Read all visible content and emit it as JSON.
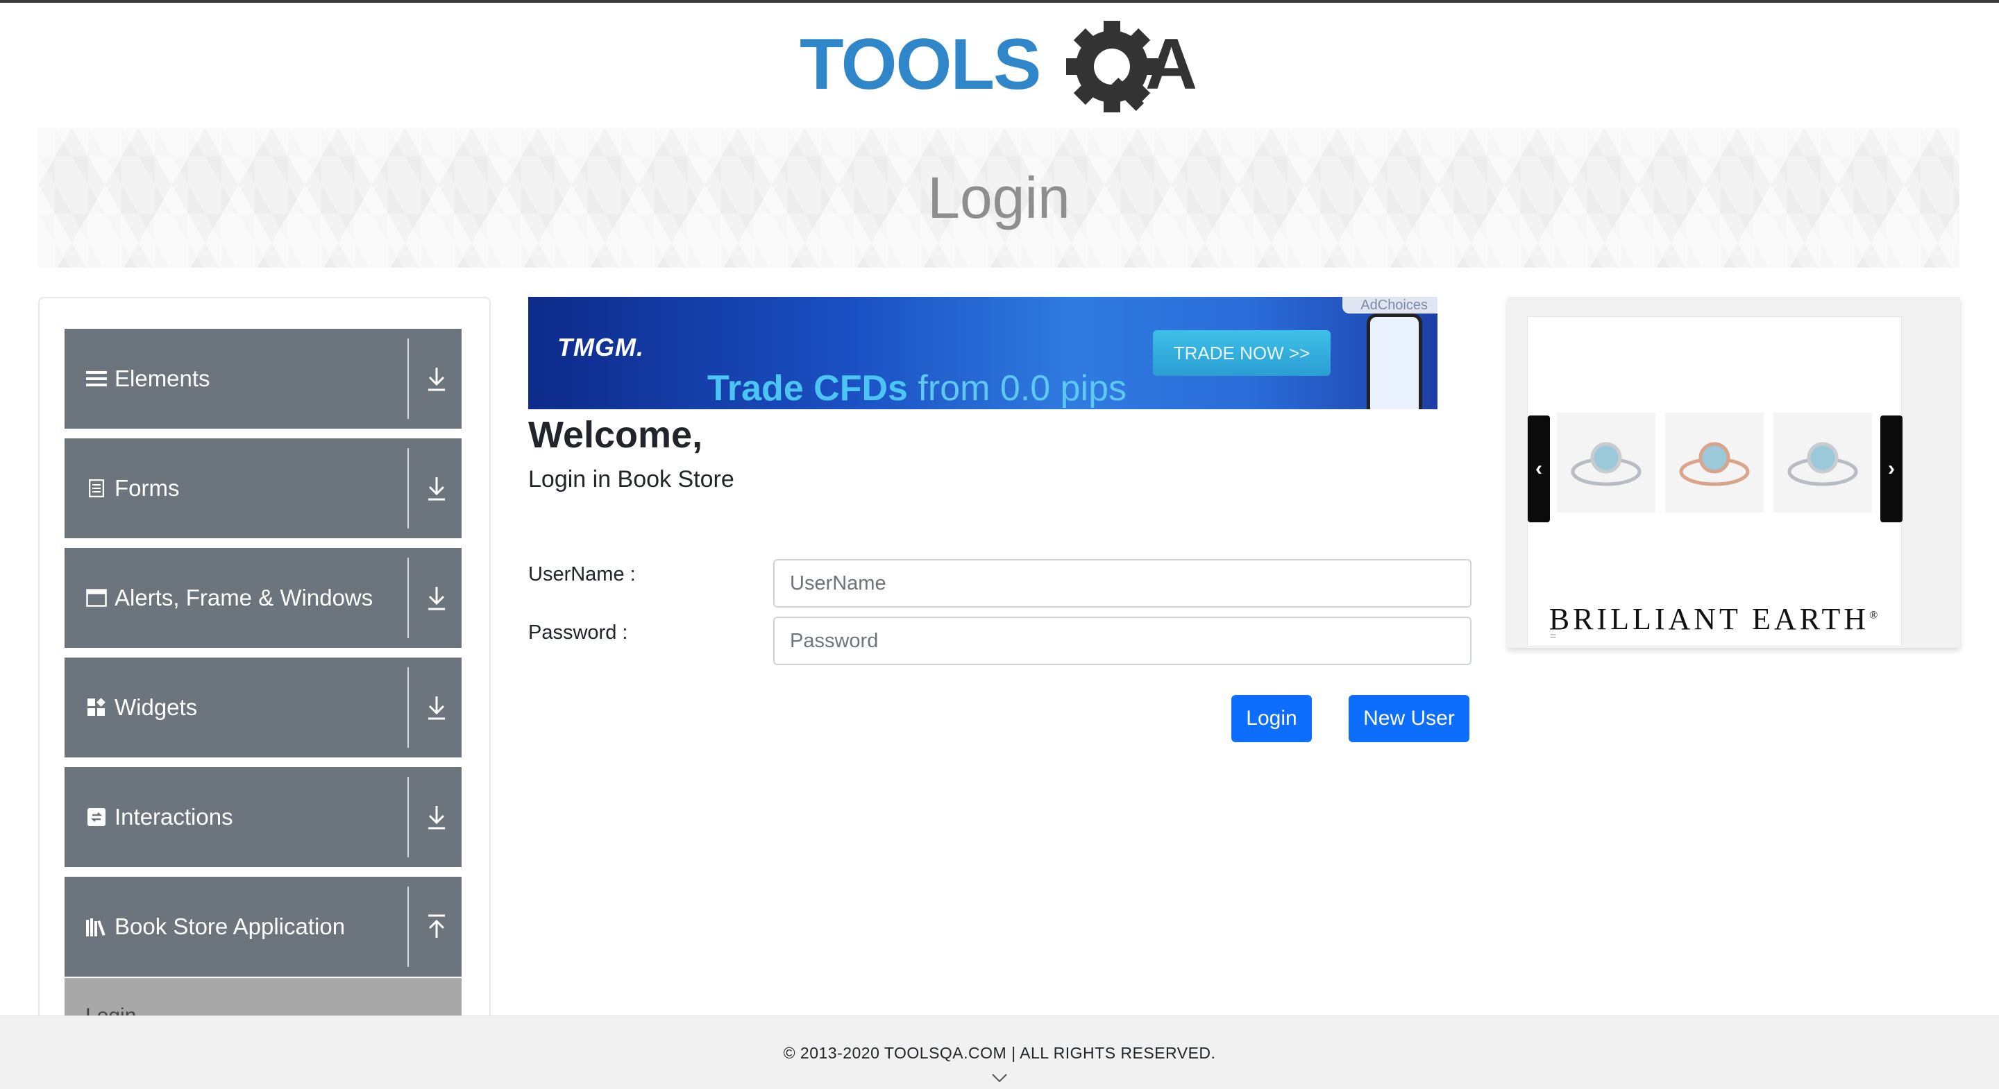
{
  "logo": {
    "text_main": "TOOLS",
    "text_q": "Q",
    "text_a": "A",
    "colors": {
      "blue": "#2f86c8",
      "dark": "#333333"
    }
  },
  "banner": {
    "title": "Login"
  },
  "sidebar": {
    "groups": [
      {
        "label": "Elements",
        "icon": "hamburger-icon",
        "arrow": "download-arrow-icon"
      },
      {
        "label": "Forms",
        "icon": "document-icon",
        "arrow": "download-arrow-icon"
      },
      {
        "label": "Alerts, Frame & Windows",
        "icon": "window-icon",
        "arrow": "download-arrow-icon"
      },
      {
        "label": "Widgets",
        "icon": "widgets-icon",
        "arrow": "download-arrow-icon"
      },
      {
        "label": "Interactions",
        "icon": "interactions-icon",
        "arrow": "download-arrow-icon"
      },
      {
        "label": "Book Store Application",
        "icon": "bookshelf-icon",
        "arrow": "upload-arrow-icon"
      }
    ],
    "sub_item": {
      "label": "Login"
    }
  },
  "ad": {
    "adchoices": "AdChoices",
    "brand": "TMGM.",
    "cta": "TRADE NOW >>",
    "tag_bold": "Trade CFDs",
    "tag_rest": " from 0.0 pips",
    "colors": {
      "start": "#0e2a8a",
      "end": "#2f7be0"
    }
  },
  "main": {
    "welcome": "Welcome,",
    "subtitle": "Login in Book Store",
    "username_label": "UserName :",
    "username_placeholder": "UserName",
    "password_label": "Password :",
    "password_placeholder": "Password",
    "login_button": "Login",
    "new_user_button": "New User",
    "accent": "#0d6efd"
  },
  "ring_ad": {
    "brand": "BRILLIANT EARTH",
    "brand_mark": "®",
    "prev": "‹",
    "next": "›"
  },
  "footer": {
    "copyright": "© 2013-2020 TOOLSQA.COM | ALL RIGHTS RESERVED."
  }
}
